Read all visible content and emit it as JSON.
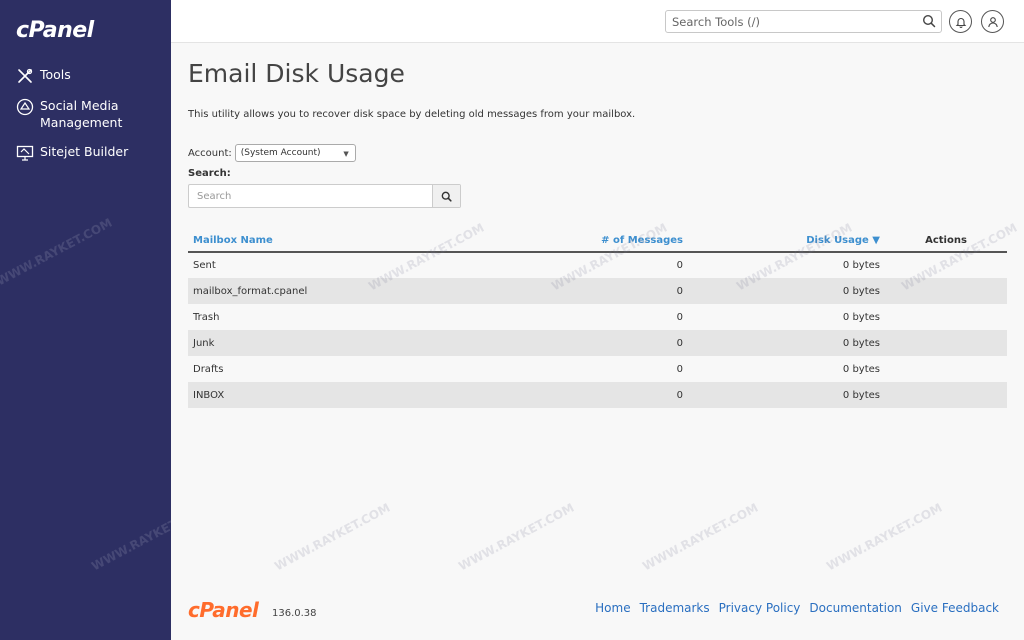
{
  "sidebar": {
    "logo": "cPanel",
    "items": [
      {
        "label": "Tools",
        "icon": "tools-icon"
      },
      {
        "label": "Social Media Management",
        "icon": "social-media-icon"
      },
      {
        "label": "Sitejet Builder",
        "icon": "sitejet-icon"
      }
    ]
  },
  "header": {
    "search_placeholder": "Search Tools (/)",
    "notifications_icon": "bell-icon",
    "user_icon": "user-icon"
  },
  "main": {
    "title": "Email Disk Usage",
    "description": "This utility allows you to recover disk space by deleting old messages from your mailbox.",
    "account_label": "Account:",
    "account_value": "(System Account)",
    "search_label": "Search:",
    "search_placeholder": "Search"
  },
  "table": {
    "columns": {
      "name": "Mailbox Name",
      "messages": "# of Messages",
      "usage": "Disk Usage ▼",
      "actions": "Actions"
    },
    "rows": [
      {
        "name": "Sent",
        "messages": "0",
        "usage": "0 bytes"
      },
      {
        "name": "mailbox_format.cpanel",
        "messages": "0",
        "usage": "0 bytes"
      },
      {
        "name": "Trash",
        "messages": "0",
        "usage": "0 bytes"
      },
      {
        "name": "Junk",
        "messages": "0",
        "usage": "0 bytes"
      },
      {
        "name": "Drafts",
        "messages": "0",
        "usage": "0 bytes"
      },
      {
        "name": "INBOX",
        "messages": "0",
        "usage": "0 bytes"
      }
    ]
  },
  "footer": {
    "logo": "cPanel",
    "version": "136.0.38",
    "links": [
      "Home",
      "Trademarks",
      "Privacy Policy",
      "Documentation",
      "Give Feedback"
    ]
  },
  "watermark": "WWW.RAYKET.COM",
  "colors": {
    "sidebar_bg": "#2d2f63",
    "link": "#3d8fcf",
    "footer_logo": "#ff6c2c"
  }
}
